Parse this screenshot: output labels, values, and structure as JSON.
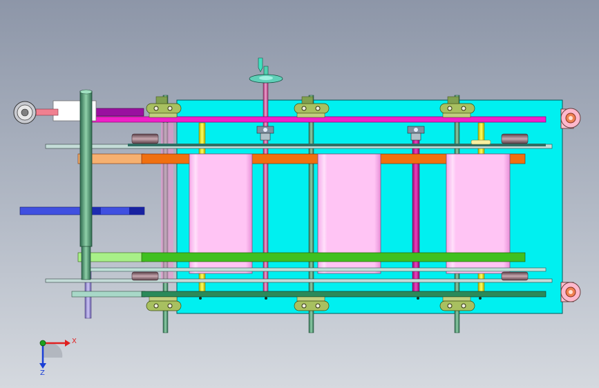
{
  "axes": {
    "x_label": "X",
    "z_label": "Z",
    "x_color": "#e02020",
    "z_color": "#1a3fd6",
    "y_color": "#1ea01e"
  },
  "palette": {
    "frame_plate": "#00f0f0",
    "pink_panel": "#ffc4f4",
    "magenta_bar": "#f020c8",
    "orange_bar": "#f07010",
    "green_bar": "#40c020",
    "dark_green_bar": "#2a8a5a",
    "purple_arm": "#9a10a0",
    "blue_arm": "#4050e0",
    "yellow_shaft": "#f0f020",
    "roller": "#ffb0c8",
    "bracket": "#90b040"
  }
}
